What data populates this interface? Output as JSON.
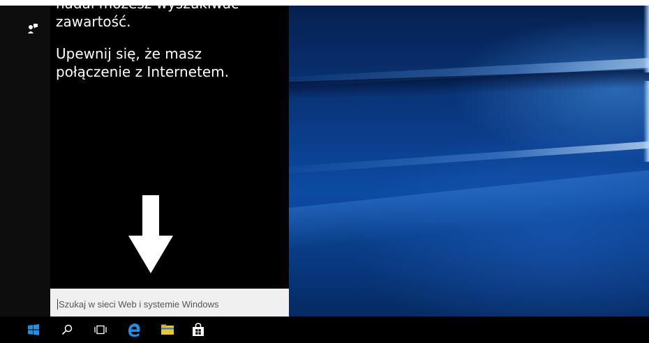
{
  "panel": {
    "message_partial": "nadal możesz wyszukiwać",
    "message_line2": "zawartość.",
    "message_p2": "Upewnij się, że masz połączenie z Internetem."
  },
  "search": {
    "text": "Szukaj w sieci Web i systemie Windows"
  },
  "taskbar": {
    "items": [
      "start-icon",
      "search-icon",
      "task-view-icon",
      "edge-icon",
      "file-explorer-icon",
      "store-icon"
    ]
  },
  "colors": {
    "accent_blue": "#1e90e6",
    "folder_yellow": "#f5c518",
    "panel_bg": "#000000",
    "search_bg": "#f0f0f0"
  }
}
